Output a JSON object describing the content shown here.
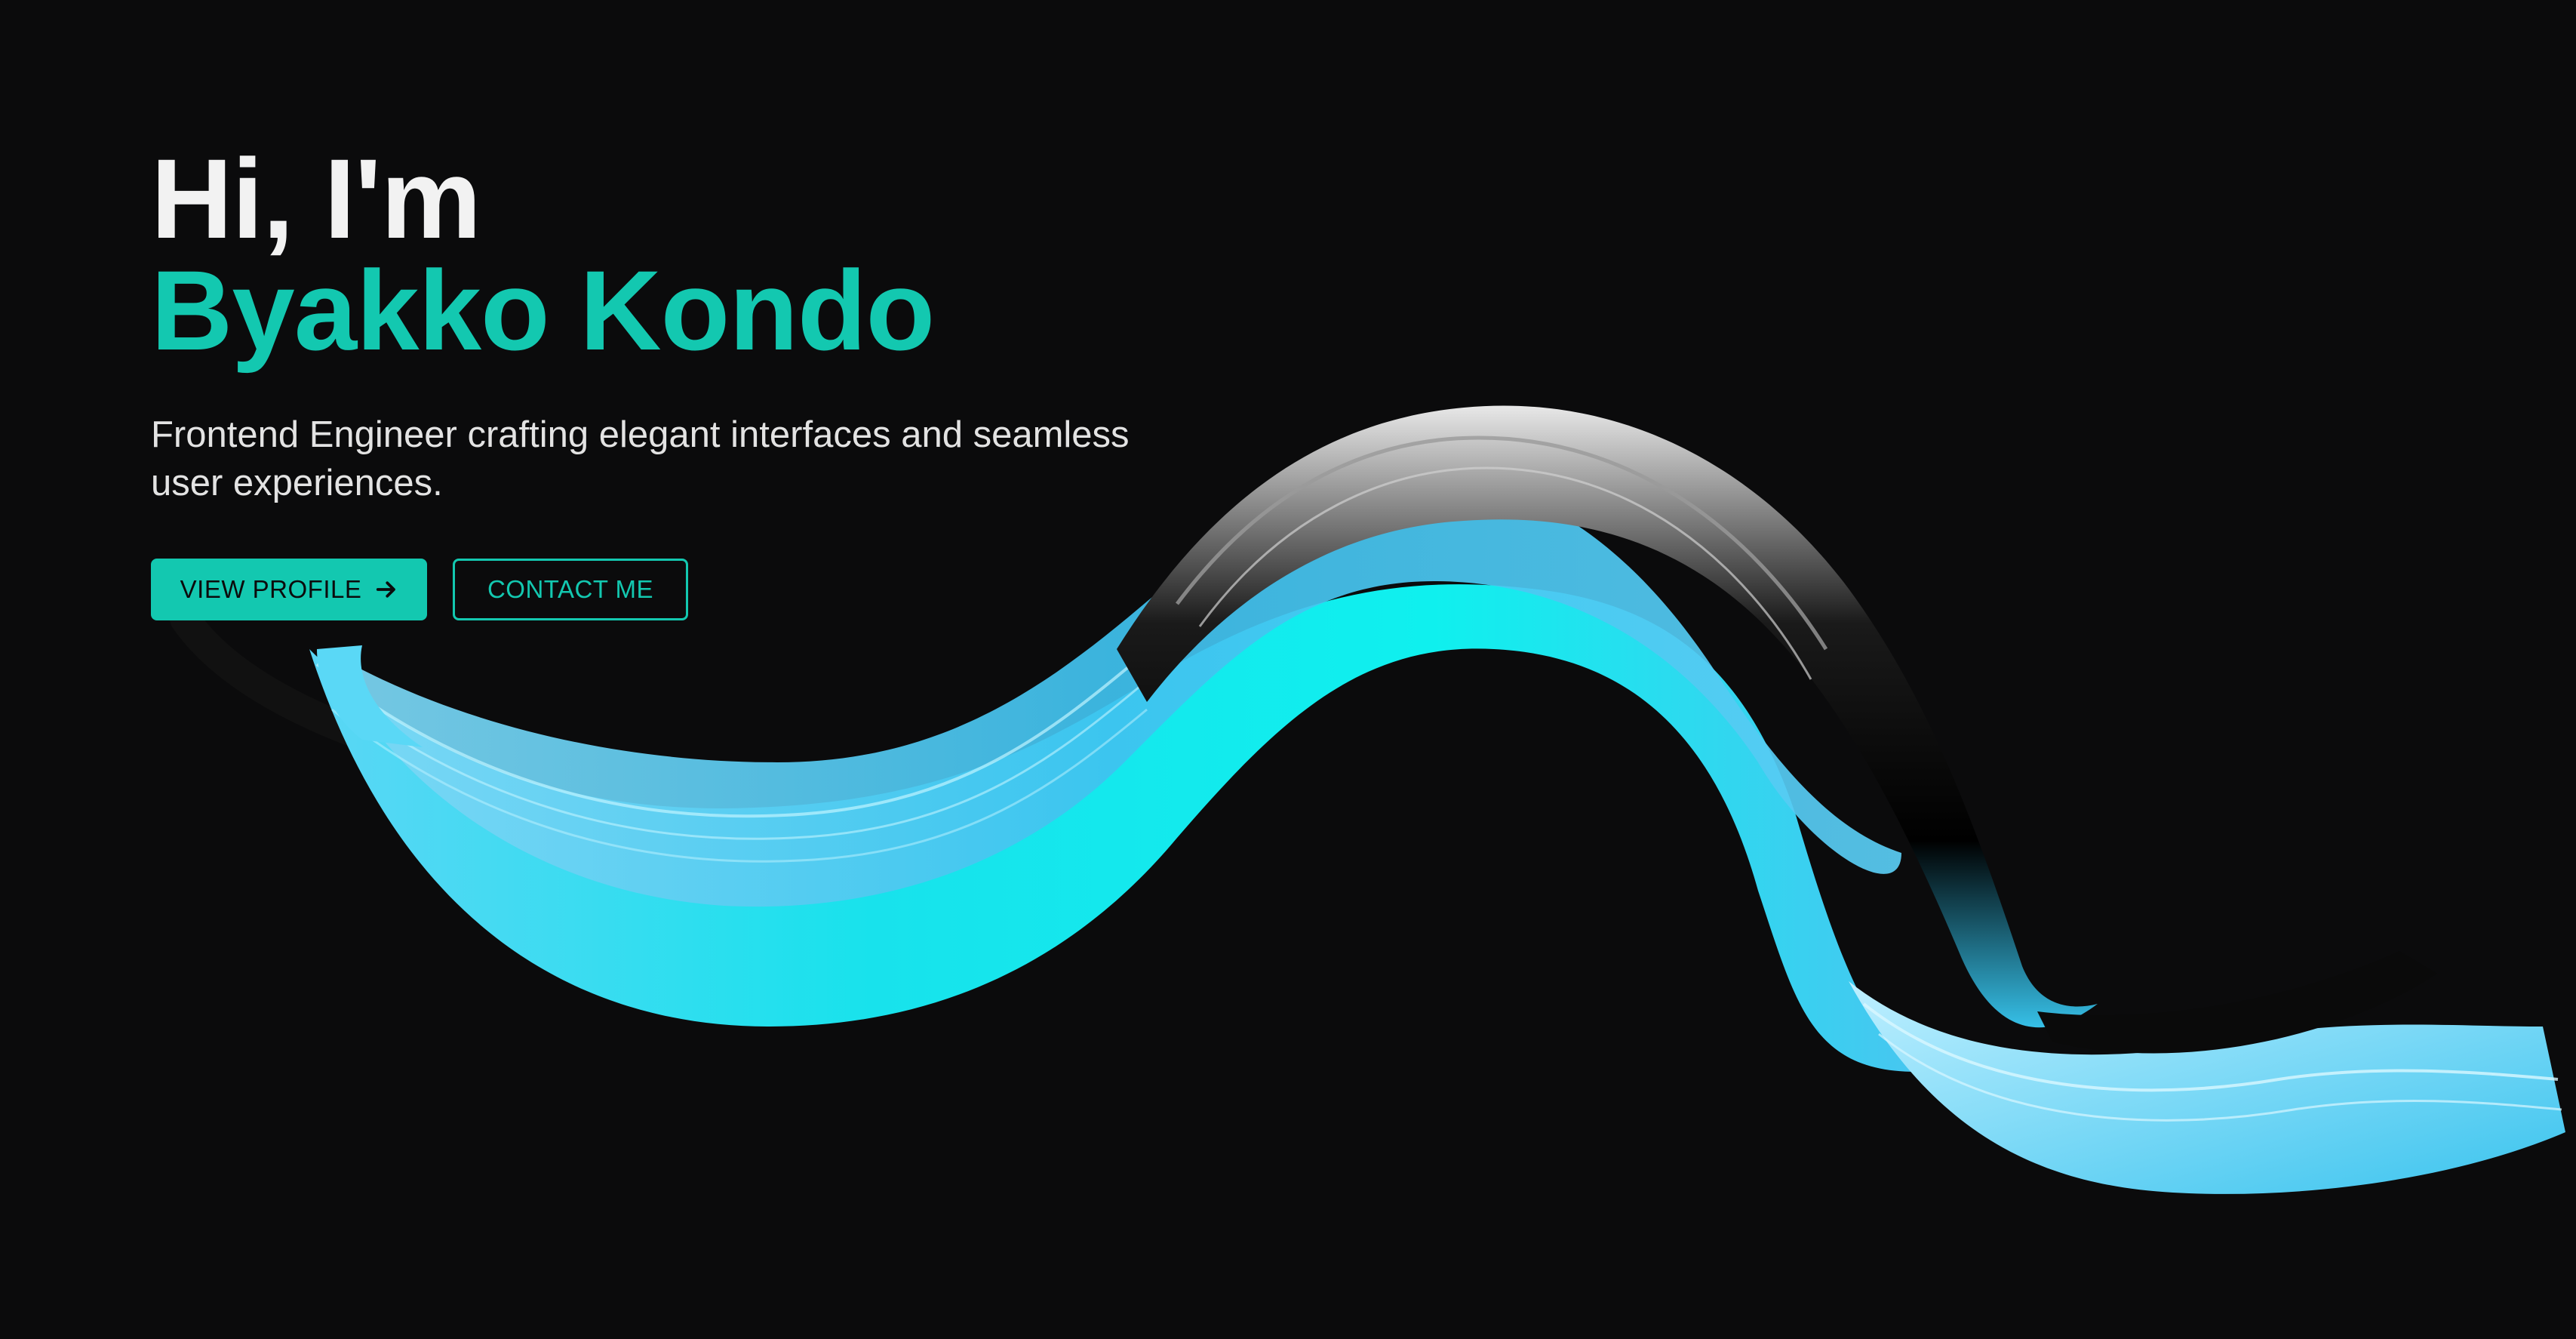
{
  "colors": {
    "background": "#0b0b0c",
    "accent": "#13c8b0",
    "ribbon_cyan": "#12e8ea",
    "ribbon_blue": "#4cc4ee"
  },
  "hero": {
    "greeting": "Hi, I'm",
    "name": "Byakko Kondo",
    "tagline": "Frontend Engineer crafting elegant interfaces and seamless user experiences."
  },
  "actions": {
    "primary": {
      "label": "VIEW PROFILE",
      "icon": "arrow-right-icon"
    },
    "secondary": {
      "label": "CONTACT ME"
    }
  },
  "decoration": {
    "icon": "flowing-ribbon-graphic"
  }
}
